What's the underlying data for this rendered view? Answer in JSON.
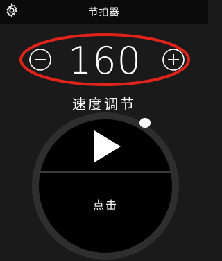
{
  "header": {
    "title": "节拍器",
    "settings_icon": "gear-icon"
  },
  "tempo": {
    "bpm": "160",
    "label": "速度调节",
    "decrease_icon": "minus-icon",
    "increase_icon": "plus-icon",
    "highlight_color": "#e0231b"
  },
  "controls": {
    "play_icon": "play-icon",
    "tap_label": "点击"
  },
  "colors": {
    "background": "#1a1a1a",
    "topbar": "#0b0b0b",
    "dial": "#000000",
    "dial_ring": "#3a3a3a",
    "text": "#ffffff"
  }
}
